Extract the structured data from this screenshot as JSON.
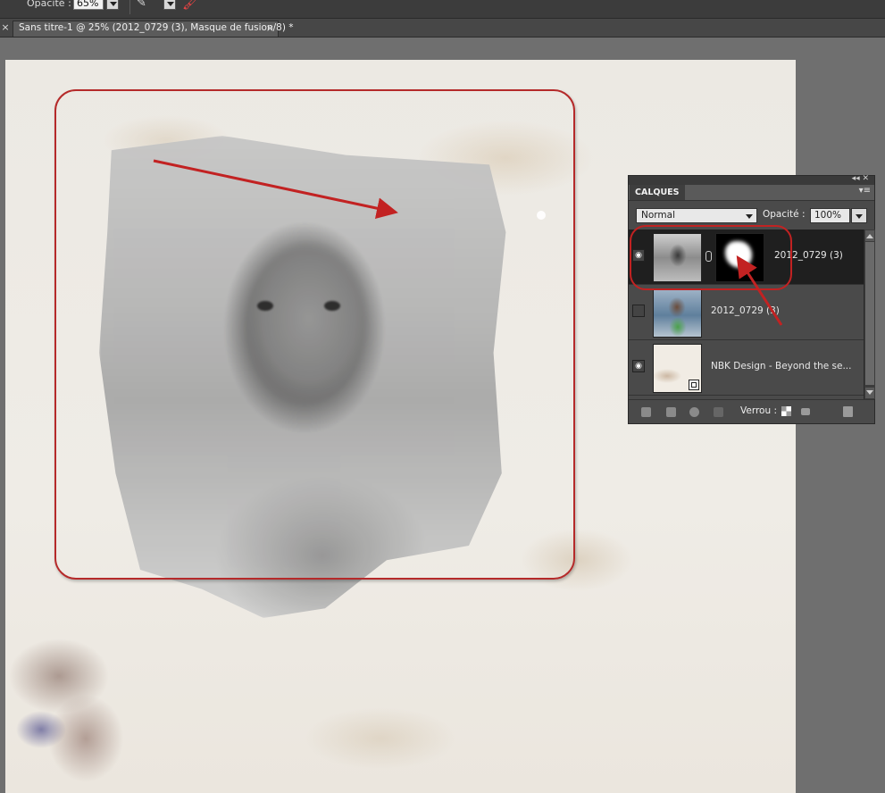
{
  "options_bar": {
    "opacity_label": "Opacité :",
    "opacity_value": "65%"
  },
  "document_tab": {
    "title": "Sans titre-1 @ 25% (2012_0729 (3), Masque de fusion/8) *",
    "close_glyph": "×",
    "left_close_glyph": "×"
  },
  "layers_panel": {
    "panel_title": "CALQUES",
    "blend_mode": "Normal",
    "opacity_label": "Opacité :",
    "opacity_value": "100%",
    "layers": [
      {
        "name": "2012_0729 (3)",
        "visible": true,
        "selected": true,
        "has_mask": true,
        "thumb": "girl-bw"
      },
      {
        "name": "2012_0729 (3)",
        "visible": false,
        "selected": false,
        "has_mask": false,
        "thumb": "girl-col"
      },
      {
        "name": "NBK Design - Beyond the se...",
        "visible": true,
        "selected": false,
        "has_mask": false,
        "thumb": "paper"
      }
    ],
    "lock_label": "Verrou :"
  },
  "annotation": {
    "accent_color": "#c22222"
  }
}
